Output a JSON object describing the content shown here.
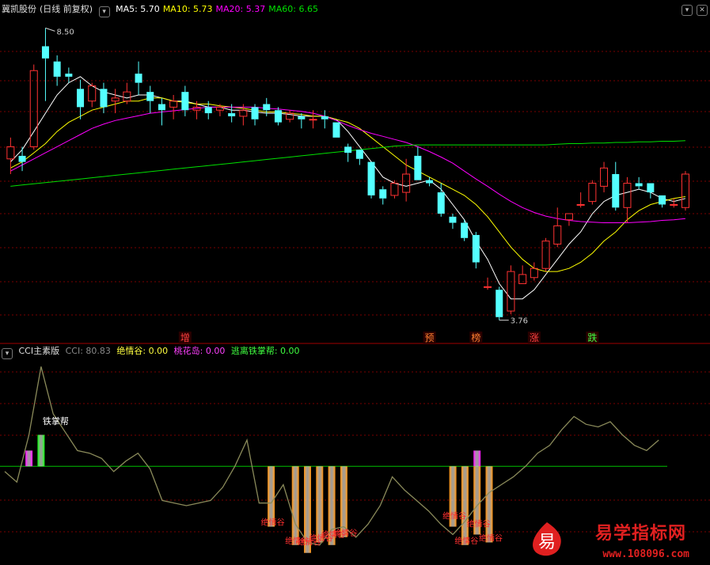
{
  "main_panel": {
    "stock_name": "冀凯股份",
    "period": "(日线 前复权)",
    "ma_labels": [
      {
        "text": "MA5: 5.70",
        "color": "#ffffff"
      },
      {
        "text": "MA10: 5.73",
        "color": "#ffff00"
      },
      {
        "text": "MA20: 5.37",
        "color": "#ff00ff"
      },
      {
        "text": "MA60: 6.65",
        "color": "#00e000"
      }
    ],
    "high_label": "8.50",
    "low_label": "3.76",
    "bottom_tags": [
      {
        "text": "增",
        "color": "#ff4040"
      },
      {
        "text": "预",
        "color": "#ff8030"
      },
      {
        "text": "榜",
        "color": "#ff8030"
      },
      {
        "text": "涨",
        "color": "#ff4040"
      },
      {
        "text": "跌",
        "color": "#40ff40"
      }
    ]
  },
  "sub_panel": {
    "title": "CCI主素版",
    "cci_label": "CCI: 80.83",
    "jqg_label": "绝情谷: 0.00",
    "thd_label": "桃花岛: 0.00",
    "tlz_label": "逃离铁掌帮: 0.00",
    "tiezhangbang": "铁掌帮",
    "jqg_mark": "绝情谷"
  },
  "watermark": {
    "name": "易学指标网",
    "url": "www.108096.com",
    "logo_char": "易"
  },
  "colors": {
    "up": "#ff3232",
    "down": "#54ffff",
    "ma5": "#ffffff",
    "ma10": "#ffff00",
    "ma20": "#ff00ff",
    "ma60": "#00e000",
    "cci": "#8a8a5a",
    "zero": "#00c000",
    "jqg_bar": "#ff8c00",
    "thd_bar": "#ff00ff",
    "tzb_bar": "#00ff00"
  },
  "chart_data": [
    {
      "type": "candlestick",
      "title": "冀凯股份",
      "ylim": [
        3.5,
        8.7
      ],
      "candles": [
        [
          6.35,
          6.55,
          6.7,
          6.1
        ],
        [
          6.4,
          6.3,
          6.55,
          6.15
        ],
        [
          6.55,
          7.8,
          7.9,
          6.5
        ],
        [
          8.2,
          8.0,
          8.5,
          7.3
        ],
        [
          7.95,
          7.7,
          8.05,
          7.55
        ],
        [
          7.75,
          7.7,
          7.85,
          7.6
        ],
        [
          7.5,
          7.2,
          7.65,
          7.0
        ],
        [
          7.3,
          7.55,
          7.6,
          7.2
        ],
        [
          7.5,
          7.2,
          7.6,
          7.1
        ],
        [
          7.3,
          7.35,
          7.5,
          7.1
        ],
        [
          7.3,
          7.45,
          7.6,
          7.25
        ],
        [
          7.75,
          7.6,
          7.95,
          7.4
        ],
        [
          7.45,
          7.3,
          7.55,
          7.1
        ],
        [
          7.25,
          7.15,
          7.35,
          6.9
        ],
        [
          7.2,
          7.3,
          7.4,
          7.0
        ],
        [
          7.45,
          7.15,
          7.55,
          7.05
        ],
        [
          7.15,
          7.2,
          7.3,
          7.0
        ],
        [
          7.2,
          7.1,
          7.3,
          7.0
        ],
        [
          7.15,
          7.2,
          7.25,
          7.05
        ],
        [
          7.1,
          7.05,
          7.25,
          6.95
        ],
        [
          7.05,
          7.15,
          7.25,
          6.9
        ],
        [
          7.2,
          7.0,
          7.25,
          6.9
        ],
        [
          7.25,
          7.15,
          7.35,
          7.05
        ],
        [
          7.15,
          6.95,
          7.2,
          6.9
        ],
        [
          7.0,
          7.1,
          7.15,
          6.95
        ],
        [
          7.05,
          7.0,
          7.1,
          6.85
        ],
        [
          7.0,
          7.0,
          7.15,
          6.85
        ],
        [
          7.05,
          7.0,
          7.15,
          6.85
        ],
        [
          6.95,
          6.7,
          6.95,
          6.7
        ],
        [
          6.55,
          6.45,
          6.6,
          6.3
        ],
        [
          6.5,
          6.35,
          6.5,
          6.25
        ],
        [
          6.3,
          5.75,
          6.3,
          5.7
        ],
        [
          5.85,
          5.7,
          5.9,
          5.6
        ],
        [
          5.75,
          5.95,
          6.0,
          5.7
        ],
        [
          5.8,
          6.1,
          6.35,
          5.65
        ],
        [
          6.4,
          6.0,
          6.55,
          6.0
        ],
        [
          6.0,
          5.95,
          6.05,
          5.9
        ],
        [
          5.8,
          5.45,
          5.95,
          5.4
        ],
        [
          5.4,
          5.3,
          5.45,
          5.2
        ],
        [
          5.3,
          5.05,
          5.35,
          5.0
        ],
        [
          5.1,
          4.65,
          5.15,
          4.55
        ],
        [
          4.25,
          4.25,
          4.4,
          4.2
        ],
        [
          4.2,
          3.75,
          4.25,
          3.7
        ],
        [
          3.85,
          4.5,
          4.6,
          3.8
        ],
        [
          4.3,
          4.45,
          4.6,
          4.3
        ],
        [
          4.4,
          4.55,
          4.65,
          4.35
        ],
        [
          4.55,
          5.0,
          5.05,
          4.5
        ],
        [
          4.95,
          5.25,
          5.55,
          4.9
        ],
        [
          5.35,
          5.45,
          5.45,
          5.25
        ],
        [
          5.6,
          5.6,
          5.8,
          5.55
        ],
        [
          5.65,
          5.95,
          6.0,
          5.6
        ],
        [
          5.9,
          6.2,
          6.3,
          5.8
        ],
        [
          6.1,
          5.55,
          6.3,
          5.5
        ],
        [
          5.55,
          5.95,
          6.05,
          5.3
        ],
        [
          5.95,
          5.9,
          6.05,
          5.85
        ],
        [
          5.95,
          5.8,
          5.95,
          5.7
        ],
        [
          5.75,
          5.6,
          5.75,
          5.55
        ],
        [
          5.6,
          5.6,
          5.7,
          5.55
        ],
        [
          5.55,
          6.1,
          6.15,
          5.5
        ]
      ],
      "series": [
        {
          "name": "MA5",
          "values": [
            6.3,
            6.5,
            6.8,
            7.1,
            7.4,
            7.6,
            7.7,
            7.55,
            7.45,
            7.4,
            7.35,
            7.4,
            7.4,
            7.35,
            7.3,
            7.3,
            7.25,
            7.2,
            7.2,
            7.15,
            7.15,
            7.12,
            7.1,
            7.1,
            7.08,
            7.05,
            7.05,
            7.05,
            7.0,
            6.8,
            6.55,
            6.3,
            6.05,
            5.95,
            5.9,
            5.95,
            6.0,
            5.85,
            5.6,
            5.35,
            5.0,
            4.7,
            4.3,
            4.05,
            4.05,
            4.2,
            4.45,
            4.7,
            4.95,
            5.15,
            5.45,
            5.65,
            5.75,
            5.8,
            5.85,
            5.8,
            5.7,
            5.65,
            5.7
          ]
        },
        {
          "name": "MA10",
          "values": [
            6.2,
            6.3,
            6.45,
            6.6,
            6.8,
            6.95,
            7.05,
            7.15,
            7.2,
            7.25,
            7.3,
            7.3,
            7.35,
            7.35,
            7.3,
            7.28,
            7.25,
            7.25,
            7.22,
            7.2,
            7.18,
            7.15,
            7.12,
            7.12,
            7.1,
            7.08,
            7.05,
            7.05,
            7.0,
            6.95,
            6.85,
            6.7,
            6.55,
            6.4,
            6.25,
            6.15,
            6.05,
            5.95,
            5.85,
            5.75,
            5.6,
            5.4,
            5.15,
            4.9,
            4.7,
            4.55,
            4.5,
            4.5,
            4.55,
            4.65,
            4.8,
            5.0,
            5.15,
            5.35,
            5.5,
            5.6,
            5.65,
            5.7,
            5.73
          ]
        },
        {
          "name": "MA20",
          "values": [
            6.15,
            6.25,
            6.35,
            6.45,
            6.55,
            6.65,
            6.75,
            6.85,
            6.92,
            6.98,
            7.02,
            7.06,
            7.1,
            7.12,
            7.14,
            7.16,
            7.18,
            7.2,
            7.2,
            7.2,
            7.2,
            7.2,
            7.18,
            7.17,
            7.15,
            7.13,
            7.1,
            7.05,
            6.98,
            6.9,
            6.83,
            6.77,
            6.72,
            6.67,
            6.62,
            6.55,
            6.47,
            6.38,
            6.28,
            6.15,
            6.02,
            5.9,
            5.77,
            5.65,
            5.55,
            5.47,
            5.41,
            5.37,
            5.34,
            5.32,
            5.31,
            5.3,
            5.3,
            5.3,
            5.31,
            5.32,
            5.34,
            5.35,
            5.37
          ]
        },
        {
          "name": "MA60",
          "values": [
            5.9,
            5.92,
            5.94,
            5.96,
            5.98,
            6.0,
            6.02,
            6.04,
            6.06,
            6.08,
            6.1,
            6.12,
            6.14,
            6.16,
            6.18,
            6.2,
            6.22,
            6.24,
            6.26,
            6.28,
            6.3,
            6.32,
            6.34,
            6.36,
            6.38,
            6.4,
            6.42,
            6.44,
            6.46,
            6.48,
            6.5,
            6.52,
            6.54,
            6.56,
            6.57,
            6.58,
            6.58,
            6.58,
            6.58,
            6.58,
            6.58,
            6.58,
            6.58,
            6.58,
            6.58,
            6.58,
            6.58,
            6.59,
            6.6,
            6.6,
            6.61,
            6.61,
            6.62,
            6.62,
            6.63,
            6.63,
            6.64,
            6.64,
            6.65
          ]
        }
      ]
    },
    {
      "type": "line",
      "title": "CCI主素版",
      "ylim": [
        -370,
        420
      ],
      "series": [
        {
          "name": "CCI",
          "values": [
            -20,
            -60,
            120,
            380,
            200,
            130,
            60,
            50,
            30,
            -20,
            20,
            50,
            -10,
            -130,
            -140,
            -150,
            -140,
            -130,
            -80,
            0,
            100,
            -140,
            -140,
            -70,
            -220,
            -290,
            -300,
            -240,
            -230,
            -270,
            -220,
            -150,
            -40,
            -90,
            -130,
            -170,
            -220,
            -260,
            -210,
            -150,
            -100,
            -70,
            -40,
            0,
            50,
            80,
            140,
            190,
            160,
            150,
            170,
            120,
            80,
            60,
            100
          ]
        },
        {
          "name": "绝情谷",
          "values": [
            0,
            0,
            0,
            0,
            0,
            0,
            0,
            0,
            0,
            0,
            0,
            0,
            0,
            0,
            0,
            0,
            0,
            0,
            0,
            0,
            0,
            0,
            -230,
            0,
            -300,
            -330,
            -290,
            -300,
            -270,
            0,
            0,
            0,
            0,
            0,
            0,
            0,
            0,
            -230,
            -300,
            -260,
            -290,
            0,
            0,
            0,
            0,
            0,
            0,
            0,
            0,
            0,
            0,
            0,
            0,
            0,
            0
          ]
        },
        {
          "name": "桃花岛",
          "values": [
            0,
            0,
            60,
            0,
            0,
            0,
            0,
            0,
            0,
            0,
            0,
            0,
            0,
            0,
            0,
            0,
            0,
            0,
            0,
            0,
            0,
            0,
            0,
            0,
            0,
            0,
            0,
            0,
            0,
            0,
            0,
            0,
            0,
            0,
            0,
            0,
            0,
            0,
            0,
            60,
            0,
            0,
            0,
            0,
            0,
            0,
            0,
            0,
            0,
            0,
            0,
            0,
            0,
            0,
            0
          ]
        },
        {
          "name": "逃离铁掌帮",
          "values": [
            0,
            0,
            0,
            120,
            0,
            0,
            0,
            0,
            0,
            0,
            0,
            0,
            0,
            0,
            0,
            0,
            0,
            0,
            0,
            0,
            0,
            0,
            0,
            0,
            0,
            0,
            0,
            0,
            0,
            0,
            0,
            0,
            0,
            0,
            0,
            0,
            0,
            0,
            0,
            0,
            0,
            0,
            0,
            0,
            0,
            0,
            0,
            0,
            0,
            0,
            0,
            0,
            0,
            0,
            0
          ]
        }
      ]
    }
  ]
}
